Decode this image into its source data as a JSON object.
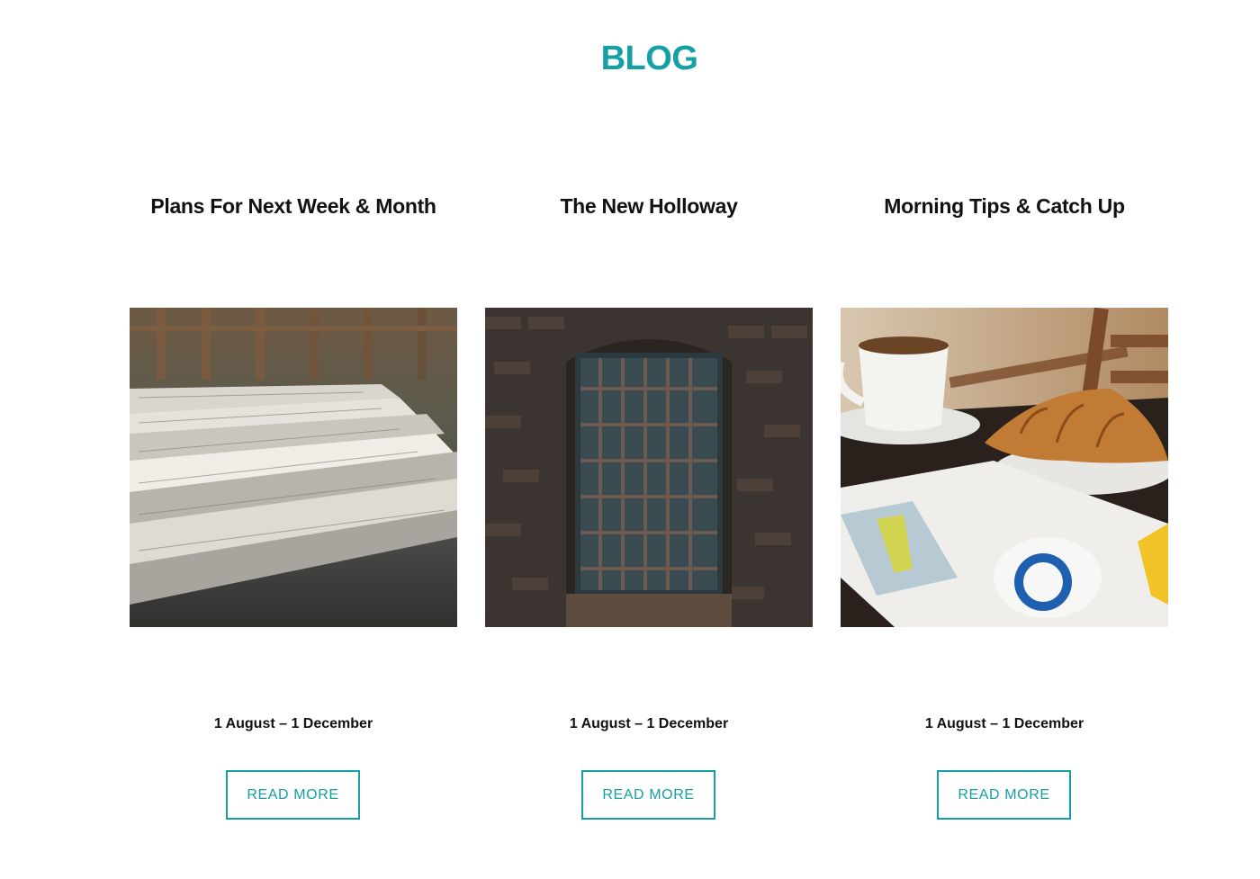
{
  "header": {
    "title": "BLOG"
  },
  "accent_color": "#15a0a6",
  "posts": [
    {
      "title": "Plans For Next Week & Month",
      "image": "newspapers-photo",
      "date": "1 August – 1 December",
      "button": "READ MORE"
    },
    {
      "title": "The New Holloway",
      "image": "barred-window-photo",
      "date": "1 August – 1 December",
      "button": "READ MORE"
    },
    {
      "title": "Morning Tips & Catch Up",
      "image": "coffee-croissant-magazine-photo",
      "date": "1 August – 1 December",
      "button": "READ MORE"
    }
  ]
}
